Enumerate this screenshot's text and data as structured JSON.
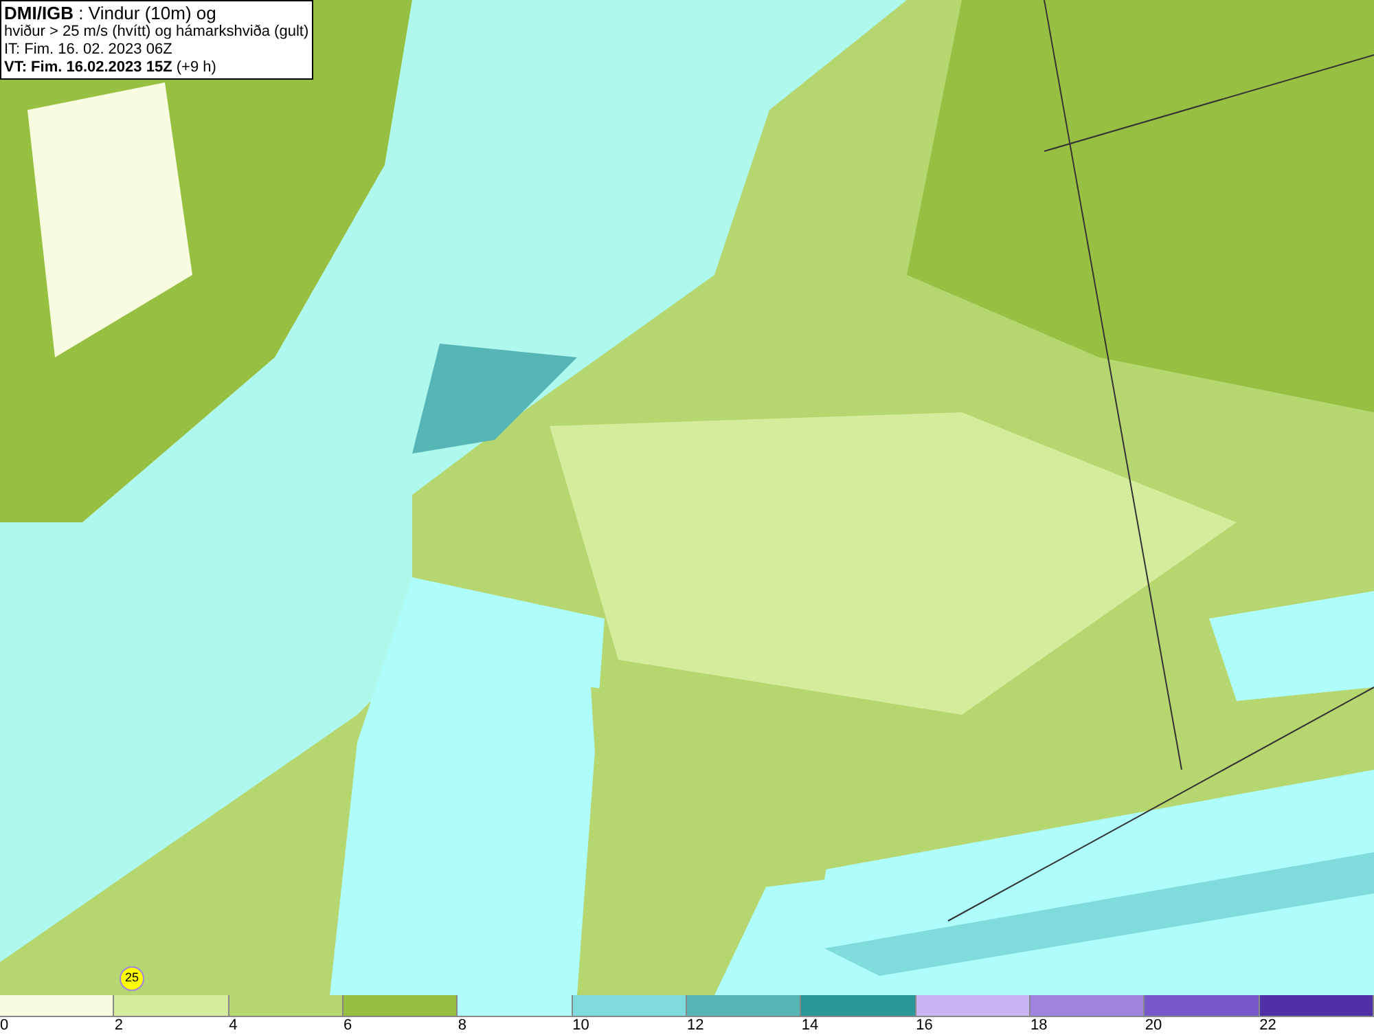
{
  "header": {
    "lines": [
      "**DMI/IGB** : Vindur (10m) og",
      "hviður > 25 m/s (hvítt) og hámarkshviða (gult)",
      "IT: Fim. 16. 02. 2023 06Z",
      "**VT: Fim. 16.02.2023 15Z** (+9 h)"
    ]
  },
  "gust_marker": {
    "value": "25"
  },
  "legend": {
    "bins": [
      {
        "label": "0",
        "color": "#f8fce0"
      },
      {
        "label": "2",
        "color": "#d5ec9c"
      },
      {
        "label": "4",
        "color": "#b6d670"
      },
      {
        "label": "6",
        "color": "#97c043"
      },
      {
        "label": "8",
        "color": "#aefcfc"
      },
      {
        "label": "10",
        "color": "#80dcdc"
      },
      {
        "label": "12",
        "color": "#56b6b6"
      },
      {
        "label": "14",
        "color": "#2a9898"
      },
      {
        "label": "16",
        "color": "#c9b5f3"
      },
      {
        "label": "18",
        "color": "#9f83de"
      },
      {
        "label": "20",
        "color": "#7658c9"
      },
      {
        "label": "22",
        "color": "#4f2fa8"
      }
    ]
  }
}
